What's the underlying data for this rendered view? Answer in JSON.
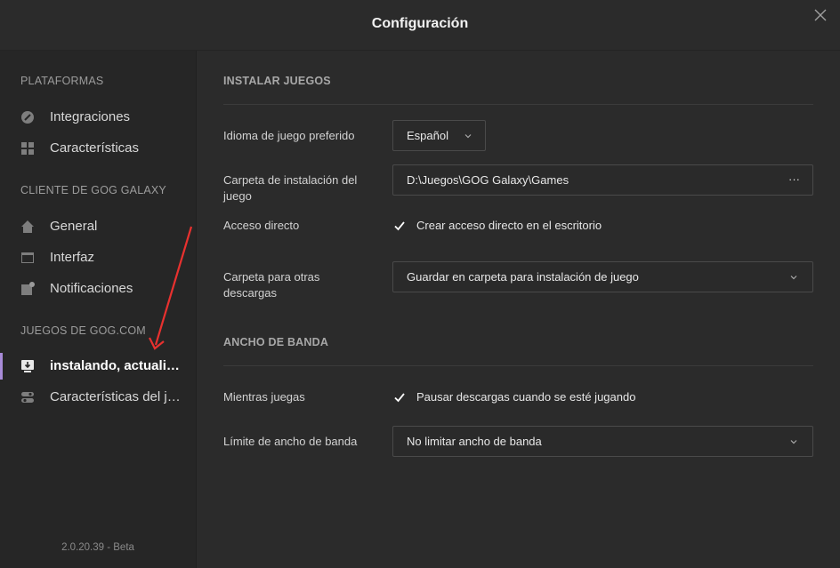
{
  "window": {
    "title": "Configuración"
  },
  "sidebar": {
    "sections": [
      {
        "heading": "PLATAFORMAS",
        "items": [
          {
            "label": "Integraciones",
            "icon": "link-icon"
          },
          {
            "label": "Características",
            "icon": "grid-icon"
          }
        ]
      },
      {
        "heading": "CLIENTE DE GOG GALAXY",
        "items": [
          {
            "label": "General",
            "icon": "home-icon"
          },
          {
            "label": "Interfaz",
            "icon": "window-icon"
          },
          {
            "label": "Notificaciones",
            "icon": "notification-icon"
          }
        ]
      },
      {
        "heading": "JUEGOS DE GOG.COM",
        "items": [
          {
            "label": "instalando, actualizando...",
            "icon": "install-icon",
            "active": true
          },
          {
            "label": "Características del juego",
            "icon": "toggle-icon"
          }
        ]
      }
    ],
    "version": "2.0.20.39 - Beta"
  },
  "install": {
    "heading": "INSTALAR JUEGOS",
    "language_label": "Idioma de juego preferido",
    "language_value": "Español",
    "folder_label": "Carpeta de instalación del juego",
    "folder_value": "D:\\Juegos\\GOG Galaxy\\Games",
    "folder_more": "···",
    "shortcut_label": "Acceso directo",
    "shortcut_text": "Crear acceso directo en el escritorio",
    "shortcut_checked": true,
    "downloads_label": "Carpeta para otras descargas",
    "downloads_value": "Guardar en carpeta para instalación de juego"
  },
  "bandwidth": {
    "heading": "ANCHO DE BANDA",
    "while_playing_label": "Mientras juegas",
    "while_playing_text": "Pausar descargas cuando se esté jugando",
    "while_playing_checked": true,
    "limit_label": "Límite de ancho de banda",
    "limit_value": "No limitar ancho de banda"
  },
  "colors": {
    "accent": "#a88bd8",
    "arrow": "#e8312f",
    "background": "#2b2b2b"
  }
}
